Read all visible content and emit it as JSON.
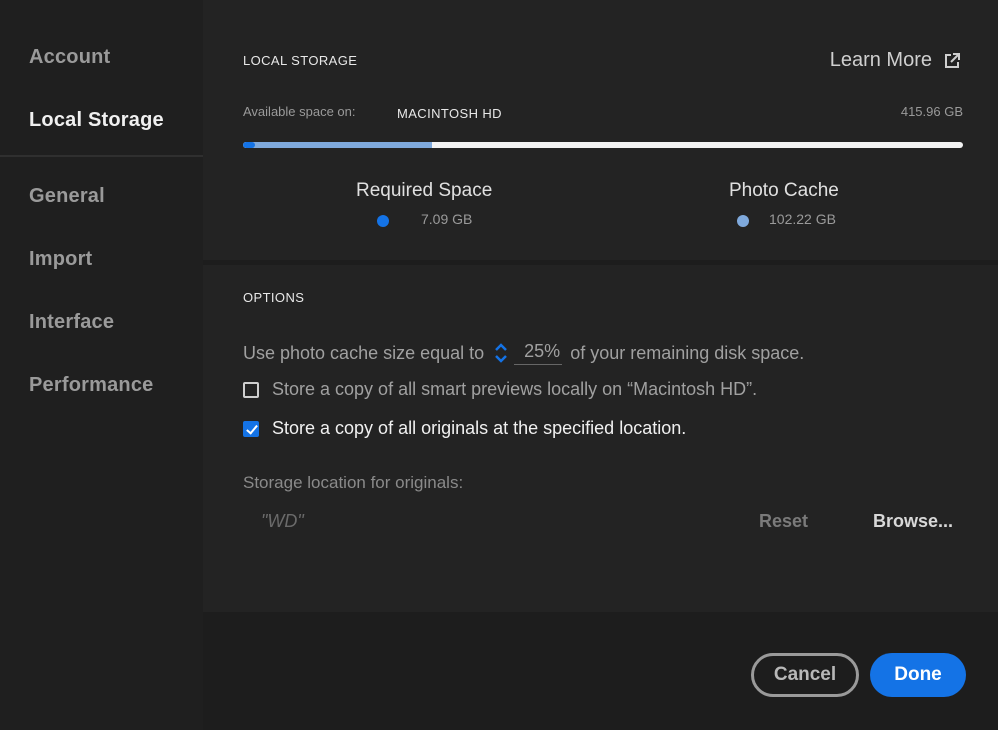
{
  "sidebar": {
    "items": [
      {
        "label": "Account",
        "active": false
      },
      {
        "label": "Local Storage",
        "active": true
      },
      {
        "label": "General",
        "active": false
      },
      {
        "label": "Import",
        "active": false
      },
      {
        "label": "Interface",
        "active": false
      },
      {
        "label": "Performance",
        "active": false
      }
    ]
  },
  "storage": {
    "title": "LOCAL STORAGE",
    "learn_more": "Learn More",
    "learn_more_icon": "external-link-icon",
    "available_label": "Available space on:",
    "drive": "MACINTOSH HD",
    "available": "415.96 GB",
    "required_label": "Required Space",
    "required_value": "7.09 GB",
    "required_fraction": 0.017,
    "cache_label": "Photo Cache",
    "cache_value": "102.22 GB",
    "cache_fraction": 0.262,
    "colors": {
      "required": "#1473e6",
      "cache": "#7fa9dc"
    }
  },
  "options": {
    "title": "OPTIONS",
    "cache_prefix": "Use photo cache size equal to",
    "cache_percent": "25%",
    "cache_suffix": "of your remaining disk space.",
    "smart_previews": {
      "label": "Store a copy of all smart previews locally on “Macintosh HD”.",
      "checked": false
    },
    "originals": {
      "label": "Store a copy of all originals at the specified location.",
      "checked": true
    },
    "location_label": "Storage location for originals:",
    "location_value": "\"WD\"",
    "reset": "Reset",
    "browse": "Browse..."
  },
  "footer": {
    "cancel": "Cancel",
    "done": "Done",
    "accent": "#1473e6"
  }
}
